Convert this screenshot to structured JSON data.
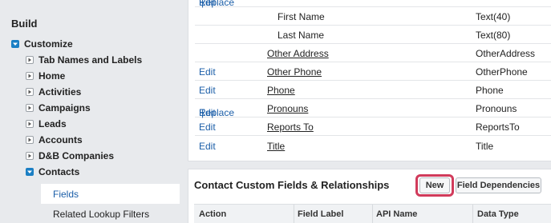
{
  "sidebar": {
    "title": "Build",
    "customize": "Customize",
    "items": [
      {
        "label": "Tab Names and Labels"
      },
      {
        "label": "Home"
      },
      {
        "label": "Activities"
      },
      {
        "label": "Campaigns"
      },
      {
        "label": "Leads"
      },
      {
        "label": "Accounts"
      },
      {
        "label": "D&B Companies"
      },
      {
        "label": "Contacts"
      }
    ],
    "active_sub": "Fields",
    "next_sub": "Related Lookup Filters"
  },
  "fields_table": {
    "rows": [
      {
        "action": "Edit | Replace",
        "label": "",
        "type": "",
        "nested": false
      },
      {
        "action": "",
        "label": "First Name",
        "type": "Text(40)",
        "nested": true
      },
      {
        "action": "",
        "label": "Last Name",
        "type": "Text(80)",
        "nested": true
      },
      {
        "action": "",
        "label": "Other Address",
        "type": "OtherAddress",
        "nested": false
      },
      {
        "action": "Edit",
        "label": "Other Phone",
        "type": "OtherPhone",
        "nested": false
      },
      {
        "action": "Edit",
        "label": "Phone",
        "type": "Phone",
        "nested": false
      },
      {
        "action": "Replace | Edit",
        "label": "Pronouns",
        "type": "Pronouns",
        "nested": false
      },
      {
        "action": "Edit",
        "label": "Reports To",
        "type": "ReportsTo",
        "nested": false
      },
      {
        "action": "Edit",
        "label": "Title",
        "type": "Title",
        "nested": false
      }
    ],
    "row1_action_a": "Edit",
    "row1_action_b": "Replace",
    "pronouns_action_a": "Replace",
    "pronouns_action_b": "Edit"
  },
  "custom_section": {
    "title": "Contact Custom Fields & Relationships",
    "new_button": "New",
    "deps_button": "Field Dependencies",
    "columns": [
      "Action",
      "Field Label",
      "API Name",
      "Data Type"
    ]
  },
  "colors": {
    "link": "#1b5ea8",
    "highlight_ring": "#d13b5b",
    "tree_box": "#1b7fc4"
  }
}
